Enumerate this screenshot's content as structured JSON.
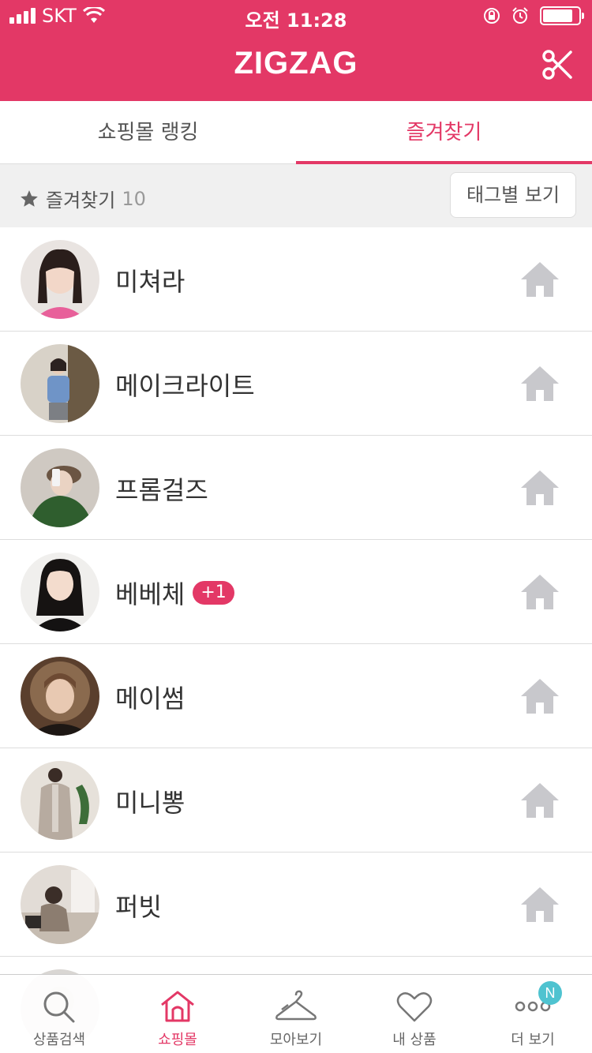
{
  "status_bar": {
    "carrier": "SKT",
    "time": "오전 11:28"
  },
  "header": {
    "logo": "ZIGZAG",
    "brand_color": "#e33866"
  },
  "tabs": [
    {
      "label": "쇼핑몰 랭킹",
      "active": false
    },
    {
      "label": "즐겨찾기",
      "active": true
    }
  ],
  "favorites": {
    "label": "즐겨찾기",
    "count": "10",
    "tag_view_button": "태그별 보기"
  },
  "shops": [
    {
      "name": "미쳐라"
    },
    {
      "name": "메이크라이트"
    },
    {
      "name": "프롬걸즈"
    },
    {
      "name": "베베체",
      "badge": "+1"
    },
    {
      "name": "메이썸"
    },
    {
      "name": "미니뽕"
    },
    {
      "name": "퍼빗"
    }
  ],
  "bottom_nav": [
    {
      "label": "상품검색",
      "icon": "search-icon",
      "active": false
    },
    {
      "label": "쇼핑몰",
      "icon": "home-icon",
      "active": true
    },
    {
      "label": "모아보기",
      "icon": "hanger-icon",
      "active": false
    },
    {
      "label": "내 상품",
      "icon": "heart-icon",
      "active": false
    },
    {
      "label": "더 보기",
      "icon": "more-icon",
      "active": false,
      "badge": "N"
    }
  ]
}
